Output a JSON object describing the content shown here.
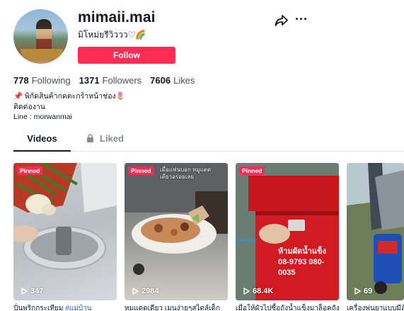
{
  "profile": {
    "username": "mimaii.mai",
    "nickname": "มิโหม่ยรีวิววว♡🌈",
    "follow_label": "Follow"
  },
  "stats": {
    "following_count": "778",
    "following_label": "Following",
    "followers_count": "1371",
    "followers_label": "Followers",
    "likes_count": "7606",
    "likes_label": "Likes"
  },
  "bio": [
    "📌 พิกัดสินค้ากดตะกร้าหน้าช่อง🌷",
    "ติดต่องาน",
    "Line : morwanmai"
  ],
  "tabs": {
    "videos": "Videos",
    "liked": "Liked"
  },
  "videos": [
    {
      "pinned": "Pinned",
      "views": "347",
      "caption": "ปั่นพริกกระเทียม ",
      "caption_tag": "#แม่บ้าน"
    },
    {
      "pinned": "Pinned",
      "views": "2984",
      "caption": "หมแดดเดียว เมนง่ายๆสไตล์เด็ก",
      "overlay": "เมื่อแฟนบอก หมูแดดเดียวอร่อยเลย"
    },
    {
      "pinned": "Pinned",
      "views": "68.4K",
      "caption": "เมื่อให้ผัวไปซื้อถังน้ำแข็งมาล็อคถัง",
      "overlay": "ห้ามผัดน้ำแข็ง 08-9793 080-0035"
    },
    {
      "views": "69",
      "caption": "เครื่องพ่นยาแบบมีล้อ"
    }
  ],
  "colors": {
    "accent": "#fe2c55",
    "text": "#161823",
    "muted": "#8a8b91",
    "hashtag": "#2b5db9"
  },
  "icons": [
    "share-icon",
    "more-icon",
    "lock-icon",
    "play-icon"
  ]
}
